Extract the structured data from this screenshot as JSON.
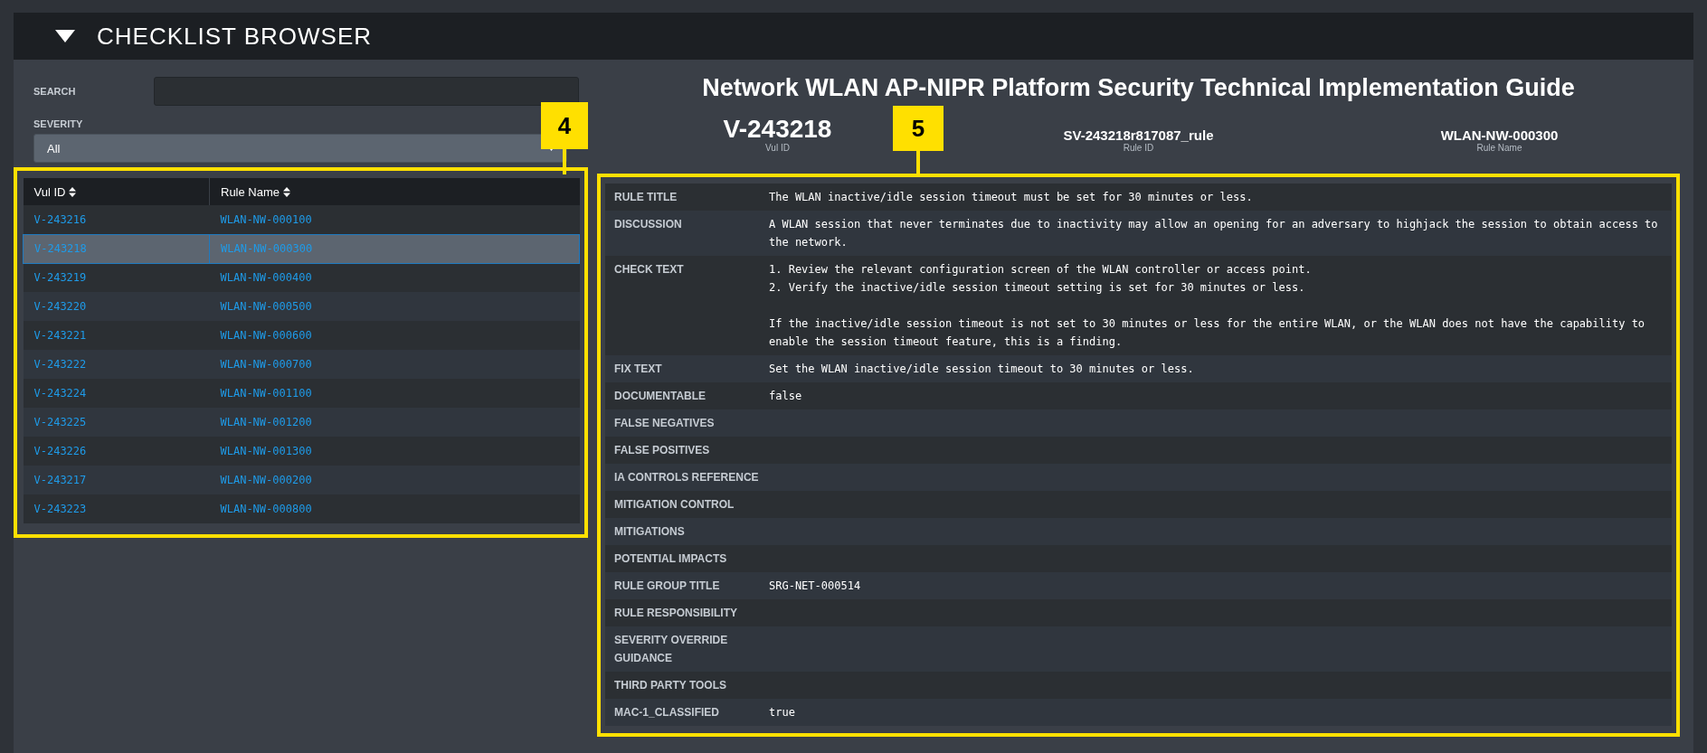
{
  "header": {
    "title": "CHECKLIST BROWSER",
    "expanded": true
  },
  "filters": {
    "search": {
      "label": "SEARCH"
    },
    "severity": {
      "label": "SEVERITY",
      "value": "All"
    }
  },
  "rules_table": {
    "columns": [
      "Vul ID",
      "Rule Name"
    ],
    "rows": [
      {
        "vul_id": "V-243216",
        "rule_name": "WLAN-NW-000100",
        "selected": false
      },
      {
        "vul_id": "V-243218",
        "rule_name": "WLAN-NW-000300",
        "selected": true
      },
      {
        "vul_id": "V-243219",
        "rule_name": "WLAN-NW-000400",
        "selected": false
      },
      {
        "vul_id": "V-243220",
        "rule_name": "WLAN-NW-000500",
        "selected": false
      },
      {
        "vul_id": "V-243221",
        "rule_name": "WLAN-NW-000600",
        "selected": false
      },
      {
        "vul_id": "V-243222",
        "rule_name": "WLAN-NW-000700",
        "selected": false
      },
      {
        "vul_id": "V-243224",
        "rule_name": "WLAN-NW-001100",
        "selected": false
      },
      {
        "vul_id": "V-243225",
        "rule_name": "WLAN-NW-001200",
        "selected": false
      },
      {
        "vul_id": "V-243226",
        "rule_name": "WLAN-NW-001300",
        "selected": false
      },
      {
        "vul_id": "V-243217",
        "rule_name": "WLAN-NW-000200",
        "selected": false
      },
      {
        "vul_id": "V-243223",
        "rule_name": "WLAN-NW-000800",
        "selected": false
      }
    ]
  },
  "detail": {
    "title": "Network WLAN AP-NIPR Platform Security Technical Implementation Guide",
    "ids": [
      {
        "kind": "primary",
        "value": "V-243218",
        "label": "Vul ID"
      },
      {
        "kind": "secondary",
        "value": "SV-243218r817087_rule",
        "label": "Rule ID"
      },
      {
        "kind": "secondary",
        "value": "WLAN-NW-000300",
        "label": "Rule Name"
      }
    ],
    "fields": [
      {
        "label": "RULE TITLE",
        "value": "The WLAN inactive/idle session timeout must be set for 30 minutes or less."
      },
      {
        "label": "DISCUSSION",
        "value": "A WLAN session that never terminates due to inactivity may allow an opening for an adversary to highjack the session to obtain access to the network."
      },
      {
        "label": "CHECK TEXT",
        "value": "1. Review the relevant configuration screen of the WLAN controller or access point.\n2. Verify the inactive/idle session timeout setting is set for 30 minutes or less.\n\nIf the inactive/idle session timeout is not set to 30 minutes or less for the entire WLAN, or the WLAN does not have the capability to enable the session timeout feature, this is a finding."
      },
      {
        "label": "FIX TEXT",
        "value": "Set the WLAN inactive/idle session timeout to 30 minutes or less."
      },
      {
        "label": "DOCUMENTABLE",
        "value": "false"
      },
      {
        "label": "FALSE NEGATIVES"
      },
      {
        "label": "FALSE POSITIVES"
      },
      {
        "label": "IA CONTROLS REFERENCE"
      },
      {
        "label": "MITIGATION CONTROL"
      },
      {
        "label": "MITIGATIONS"
      },
      {
        "label": "POTENTIAL IMPACTS"
      },
      {
        "label": "RULE GROUP TITLE",
        "value": "SRG-NET-000514"
      },
      {
        "label": "RULE RESPONSIBILITY"
      },
      {
        "label": "SEVERITY OVERRIDE GUIDANCE"
      },
      {
        "label": "THIRD PARTY TOOLS"
      },
      {
        "label": "MAC-1_CLASSIFIED",
        "value": "true"
      }
    ]
  },
  "callouts": [
    {
      "label": "4"
    },
    {
      "label": "5"
    }
  ]
}
